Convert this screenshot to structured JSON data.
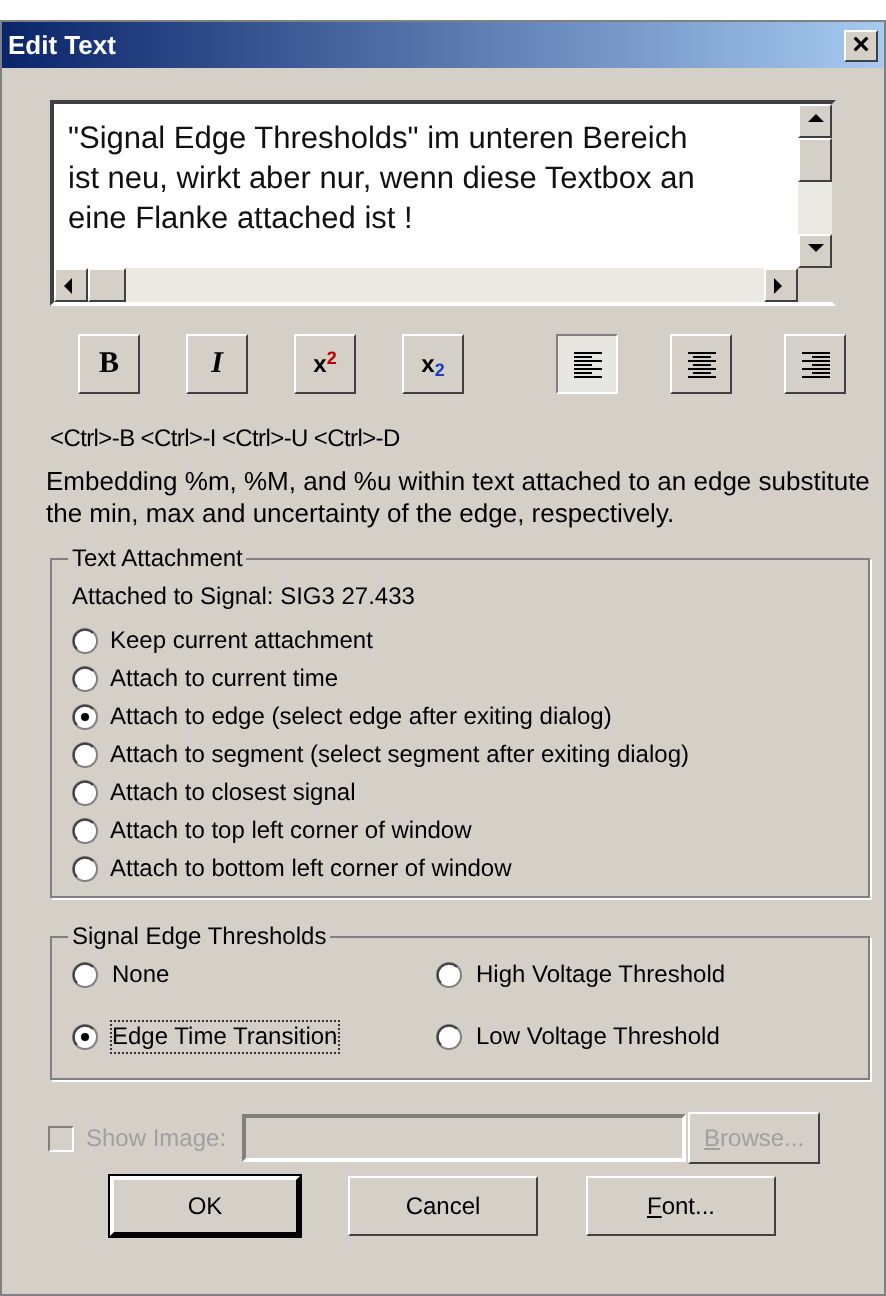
{
  "window": {
    "title": "Edit Text",
    "close": "×"
  },
  "text_box": {
    "value": "\"Signal Edge Thresholds\" im unteren Bereich ist neu, wirkt aber nur, wenn diese Textbox an eine Flanke attached ist !"
  },
  "format_buttons": [
    {
      "kind": "bold",
      "label": "B",
      "selected": false
    },
    {
      "kind": "italic",
      "label": "I",
      "selected": false
    },
    {
      "kind": "superscript",
      "label": "x$^{2}$",
      "selected": false
    },
    {
      "kind": "subscript",
      "label": "x$_{2}$",
      "selected": false
    },
    {
      "kind": "align-left",
      "selected": true
    },
    {
      "kind": "align-center",
      "selected": false
    },
    {
      "kind": "align-right",
      "selected": false
    }
  ],
  "shortcuts": "<Ctrl>-B <Ctrl>-I <Ctrl>-U <Ctrl>-D",
  "description": "Embedding %m, %M, and %u  within text attached to an edge substitute the min, max and uncertainty of the edge, respectively.",
  "text_attachment": {
    "title": "Text Attachment",
    "attached_to": "Attached to Signal: SIG3 27.433",
    "options": [
      {
        "label": "Keep current attachment",
        "selected": false
      },
      {
        "label": "Attach to current time",
        "selected": false
      },
      {
        "label": "Attach to edge (select edge after exiting dialog)",
        "selected": true
      },
      {
        "label": "Attach to segment (select segment after exiting dialog)",
        "selected": false
      },
      {
        "label": "Attach to closest signal",
        "selected": false
      },
      {
        "label": "Attach to top left corner of window",
        "selected": false
      },
      {
        "label": "Attach to bottom left corner of window",
        "selected": false
      }
    ]
  },
  "signal_edge_thresholds": {
    "title": "Signal Edge Thresholds",
    "options": [
      {
        "label": "None",
        "selected": false,
        "focused": false
      },
      {
        "label": "High Voltage Threshold",
        "selected": false,
        "focused": false
      },
      {
        "label": "Edge Time Transition",
        "selected": true,
        "focused": true
      },
      {
        "label": "Low Voltage Threshold",
        "selected": false,
        "focused": false
      }
    ]
  },
  "show_image": {
    "label": "Show Image:",
    "checked": false,
    "disabled": true,
    "browse": {
      "label": "Browse...",
      "underline_first": true
    }
  },
  "buttons": [
    {
      "label": "OK",
      "default": true,
      "underline_first": false
    },
    {
      "label": "Cancel",
      "default": false,
      "underline_first": false
    },
    {
      "label": "Font...",
      "default": false,
      "underline_first": true
    }
  ]
}
